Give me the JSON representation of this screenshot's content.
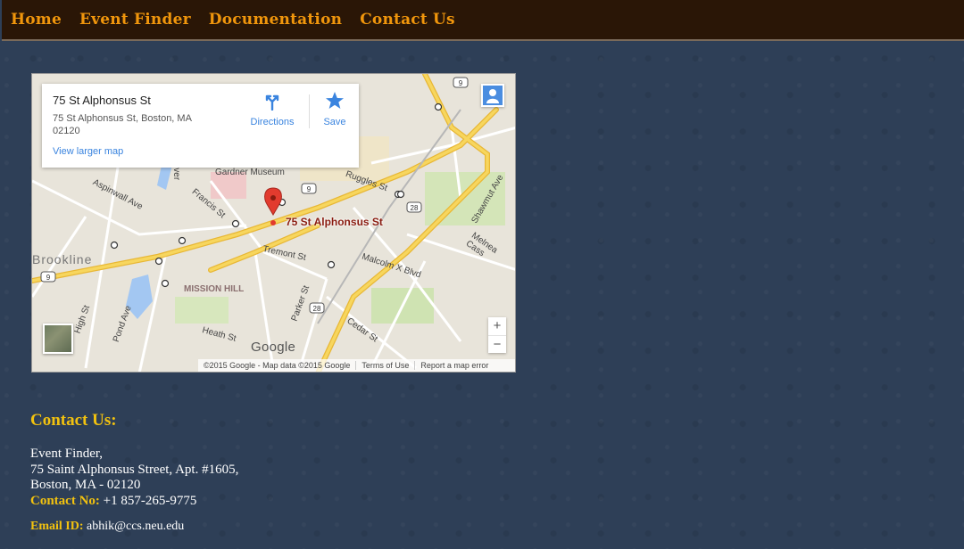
{
  "nav": {
    "items": [
      "Home",
      "Event Finder",
      "Documentation",
      "Contact Us"
    ]
  },
  "map": {
    "place_title": "75 St Alphonsus St",
    "place_address": "75 St Alphonsus St, Boston, MA 02120",
    "view_larger": "View larger map",
    "directions_label": "Directions",
    "save_label": "Save",
    "marker_label": "75 St Alphonsus St",
    "zoom_in": "+",
    "zoom_out": "−",
    "google_logo": "Google",
    "attribution": [
      "©2015 Google - Map data ©2015 Google",
      "Terms of Use",
      "Report a map error"
    ],
    "street_labels": {
      "gardner": "Gardner Museum",
      "ruggles": "Ruggles St",
      "francis": "Francis St",
      "aspinwall": "Aspinwall Ave",
      "brookline": "Brookline",
      "tremont": "Tremont St",
      "malcolm": "Malcolm X Blvd",
      "mission": "MISSION HILL",
      "parker": "Parker St",
      "heath": "Heath St",
      "cedar": "Cedar St",
      "high": "High St",
      "pond": "Pond Ave",
      "shawmut": "Shawmut Ave",
      "melnea": "Melnea Cass",
      "river": "River",
      "route9": "9",
      "route28": "28"
    },
    "colors": {
      "road_major": "#f6d15a",
      "road_border": "#e0b030",
      "park": "#c5dea3",
      "water": "#a3c7f2",
      "marker": "#e23b2e"
    }
  },
  "contact": {
    "heading": "Contact Us:",
    "org": "Event Finder,",
    "street": "75 Saint Alphonsus Street, Apt. #1605,",
    "city": "Boston, MA - 02120",
    "phone_label": "Contact No:",
    "phone": "+1 857-265-9775",
    "email_label": "Email ID:",
    "email": "abhik@ccs.neu.edu"
  }
}
